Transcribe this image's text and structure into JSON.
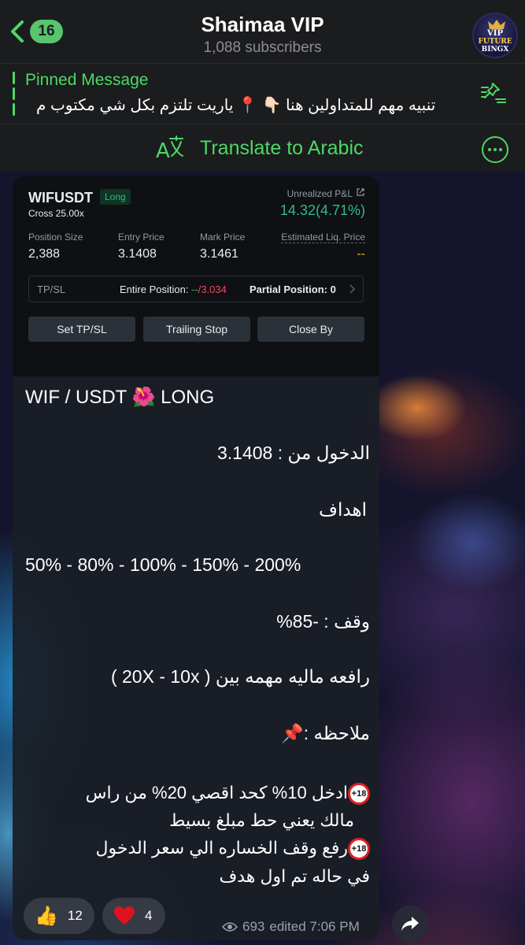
{
  "header": {
    "back_count": "16",
    "title": "Shaimaa VIP",
    "subscribers": "1,088 subscribers",
    "avatar_text": [
      "VIP",
      "FUTURE",
      "BINGX"
    ]
  },
  "pinned": {
    "label": "Pinned Message",
    "text": "تنبيه مهم للمتداولين هنا 👇🏻 📍 ياريت تلتزم بكل شي مكتوب م"
  },
  "translate": {
    "label": "Translate to Arabic"
  },
  "card": {
    "symbol": "WIFUSDT",
    "side": "Long",
    "margin": "Cross 25.00x",
    "pnl_label": "Unrealized P&L",
    "pnl_value": "14.32(4.71%)",
    "position_size_label": "Position Size",
    "position_size": "2,388",
    "entry_price_label": "Entry Price",
    "entry_price": "3.1408",
    "mark_price_label": "Mark Price",
    "mark_price": "3.1461",
    "liq_price_label": "Estimated Liq. Price",
    "liq_price": "--",
    "tpsl_label": "TP/SL",
    "entire_label": "Entire Position: ",
    "entire_tp": "--",
    "entire_sl": "/3.034",
    "partial_label": "Partial Position: 0",
    "buttons": [
      "Set TP/SL",
      "Trailing Stop",
      "Close By"
    ]
  },
  "message": {
    "title": "WIF / USDT 🌺 LONG",
    "entry": "الدخول من : 3.1408",
    "targets_label": "اهداف",
    "targets": "50% - 80% - 100% - 150% - 200%",
    "stop": "وقف : -85%",
    "leverage": "رافعه ماليه مهمه بين ( 20X - 10x )",
    "note_label": "ملاحظه :",
    "note_icon": "📌",
    "note_line1": "ادخل 10% كحد اقصي 20% من راس",
    "note_line2": "مالك  يعني حط مبلغ بسيط",
    "note_line3": "رفع وقف الخساره الي سعر الدخول",
    "note_line4": "في حاله تم اول هدف",
    "badge_18": "18+"
  },
  "reactions": [
    {
      "emoji": "👍",
      "count": "12"
    },
    {
      "emoji": "❤️",
      "count": "4"
    }
  ],
  "meta": {
    "views": "693",
    "edited_time": "edited 7:06 PM"
  },
  "colors": {
    "accent_green": "#4cd964",
    "pnl_green": "#2ebd85",
    "sl_red": "#f6465d"
  }
}
